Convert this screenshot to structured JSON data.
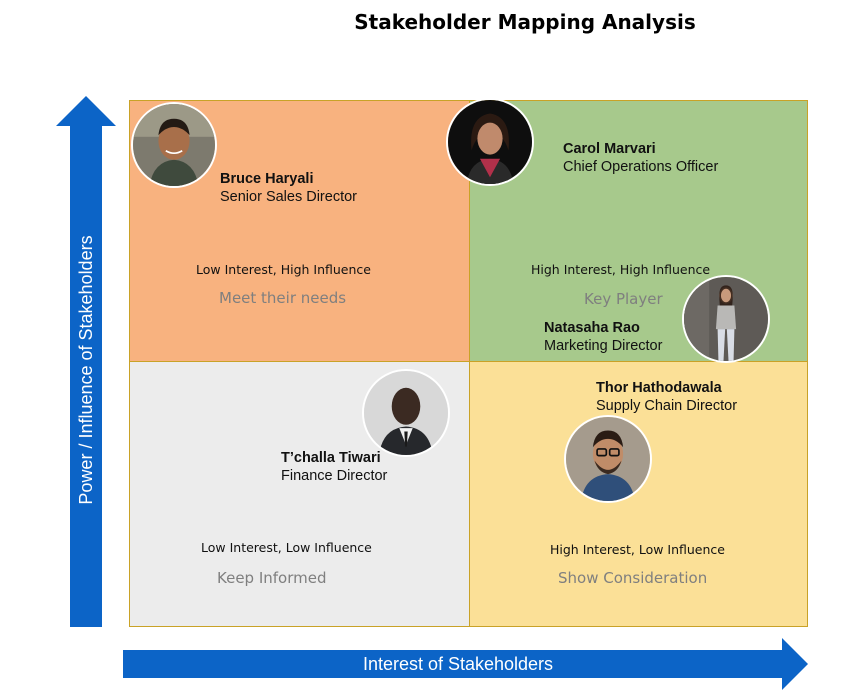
{
  "title": "Stakeholder Mapping Analysis",
  "axes": {
    "y_label": "Power / Influence of Stakeholders",
    "x_label": "Interest of Stakeholders",
    "arrow_color": "#0c64c7"
  },
  "quadrants": {
    "top_left": {
      "color": "#f8b27f",
      "category": "Low Interest, High Influence",
      "strategy": "Meet their needs",
      "stakeholders": [
        {
          "name": "Bruce Haryali",
          "role": "Senior Sales Director"
        }
      ]
    },
    "top_right": {
      "color": "#a7c98c",
      "category": "High Interest, High Influence",
      "strategy": "Key Player",
      "stakeholders": [
        {
          "name": "Carol Marvari",
          "role": "Chief Operations Officer"
        },
        {
          "name": "Natasaha Rao",
          "role": "Marketing Director"
        }
      ]
    },
    "bottom_left": {
      "color": "#ececec",
      "category": "Low Interest, Low Influence",
      "strategy": "Keep Informed",
      "stakeholders": [
        {
          "name": "T’challa Tiwari",
          "role": "Finance Director"
        }
      ]
    },
    "bottom_right": {
      "color": "#fbe097",
      "category": "High Interest, Low Influence",
      "strategy": "Show Consideration",
      "stakeholders": [
        {
          "name": "Thor Hathodawala",
          "role": "Supply Chain Director"
        }
      ]
    }
  }
}
